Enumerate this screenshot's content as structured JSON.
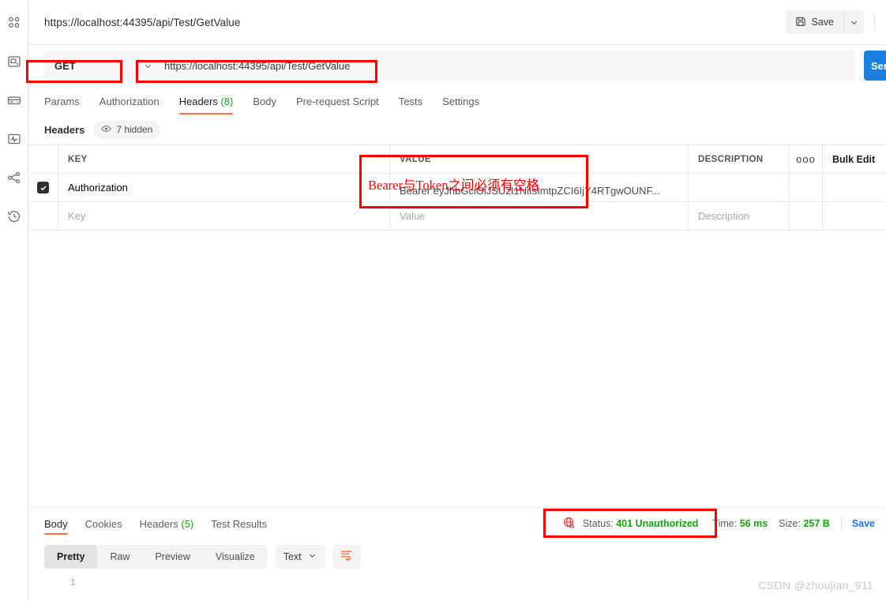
{
  "sidebar": {
    "items": [
      {
        "name": "collections-icon",
        "label": "Collections"
      },
      {
        "name": "apis-icon",
        "label": "APIs"
      },
      {
        "name": "environments-icon",
        "label": "Environments"
      },
      {
        "name": "mock-servers-icon",
        "label": "Mock Servers"
      },
      {
        "name": "monitors-icon",
        "label": "Monitors"
      },
      {
        "name": "history-icon",
        "label": "History"
      }
    ]
  },
  "topbar": {
    "request_title": "https://localhost:44395/api/Test/GetValue",
    "save_label": "Save"
  },
  "request": {
    "method": "GET",
    "url": "https://localhost:44395/api/Test/GetValue",
    "send_label": "Send",
    "tabs": [
      {
        "label": "Params",
        "count": "",
        "active": false
      },
      {
        "label": "Authorization",
        "count": "",
        "active": false
      },
      {
        "label": "Headers",
        "count": "(8)",
        "active": true
      },
      {
        "label": "Body",
        "count": "",
        "active": false
      },
      {
        "label": "Pre-request Script",
        "count": "",
        "active": false
      },
      {
        "label": "Tests",
        "count": "",
        "active": false
      },
      {
        "label": "Settings",
        "count": "",
        "active": false
      }
    ]
  },
  "headers_section": {
    "title": "Headers",
    "hidden_chip": "7 hidden",
    "columns": {
      "key": "KEY",
      "value": "VALUE",
      "description": "DESCRIPTION"
    },
    "bulk_edit": "Bulk Edit",
    "dots": "ooo",
    "rows": [
      {
        "checked": true,
        "key": "Authorization",
        "value": "Bearer eyJhbGciOiJSUzI1NiIsImtpZCI6IjY4RTgwOUNF...",
        "description": ""
      }
    ],
    "placeholders": {
      "key": "Key",
      "value": "Value",
      "description": "Description"
    }
  },
  "response": {
    "tabs": [
      {
        "label": "Body",
        "count": "",
        "active": true
      },
      {
        "label": "Cookies",
        "count": "",
        "active": false
      },
      {
        "label": "Headers",
        "count": "(5)",
        "active": false
      },
      {
        "label": "Test Results",
        "count": "",
        "active": false
      }
    ],
    "status_label": "Status:",
    "status_value": "401 Unauthorized",
    "time_label": "Time:",
    "time_value": "56 ms",
    "size_label": "Size:",
    "size_value": "257 B",
    "save_label": "Save",
    "viewer_modes": [
      {
        "label": "Pretty",
        "active": true
      },
      {
        "label": "Raw",
        "active": false
      },
      {
        "label": "Preview",
        "active": false
      },
      {
        "label": "Visualize",
        "active": false
      }
    ],
    "format": "Text",
    "line_number": "1",
    "body_text": ""
  },
  "annotations": {
    "chinese_note": "Bearer与Token之间必须有空格",
    "box_color": "#fb0000"
  },
  "watermark": "CSDN @zhoujian_911",
  "colors": {
    "accent_orange": "#ff6c37",
    "send_blue": "#1a7fe0",
    "status_green": "#13a30f",
    "annotation_red": "#fb0000"
  }
}
